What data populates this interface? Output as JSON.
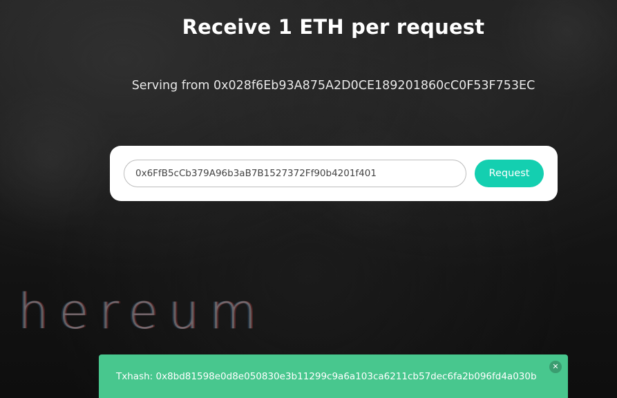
{
  "header": {
    "title": "Receive 1 ETH per request",
    "serving_text": "Serving from 0x028f6Eb93A875A2D0CE189201860cC0F53F753EC"
  },
  "form": {
    "address_value": "0x6FfB5cCb379A96b3aB7B1527372Ff90b4201f401",
    "request_label": "Request"
  },
  "background": {
    "logo_text": "hereum"
  },
  "notification": {
    "text": "Txhash: 0x8bd81598e0d8e050830e3b11299c9a6a103ca6211cb57dec6fa2b096fd4a030b",
    "close_icon": "close-icon",
    "color": "#48c78e"
  },
  "colors": {
    "accent": "#14cfb0",
    "card": "#ffffff"
  }
}
